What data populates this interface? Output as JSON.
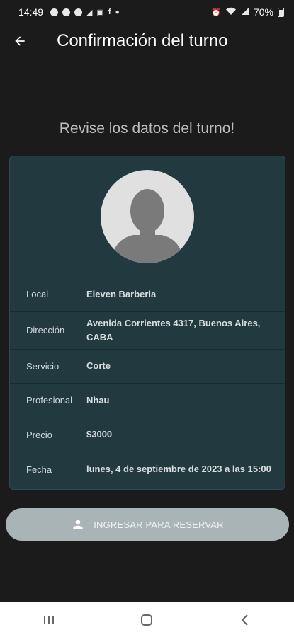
{
  "status_bar": {
    "time": "14:49",
    "battery": "70%"
  },
  "app_bar": {
    "title": "Confirmación del turno"
  },
  "subtitle": "Revise los datos del turno!",
  "details": [
    {
      "label": "Local",
      "value": "Eleven Barberia"
    },
    {
      "label": "Dirección",
      "value": "Avenida Corrientes 4317, Buenos Aires, CABA"
    },
    {
      "label": "Servicio",
      "value": "Corte"
    },
    {
      "label": "Profesional",
      "value": "Nhau"
    },
    {
      "label": "Precio",
      "value": "$3000"
    },
    {
      "label": "Fecha",
      "value": "lunes, 4 de septiembre de 2023 a las 15:00"
    }
  ],
  "reserve_button": {
    "label": "INGRESAR PARA RESERVAR",
    "icon": "person-icon"
  },
  "colors": {
    "background": "#1b1b1b",
    "card": "#223940",
    "button": "#a9b4b7"
  }
}
